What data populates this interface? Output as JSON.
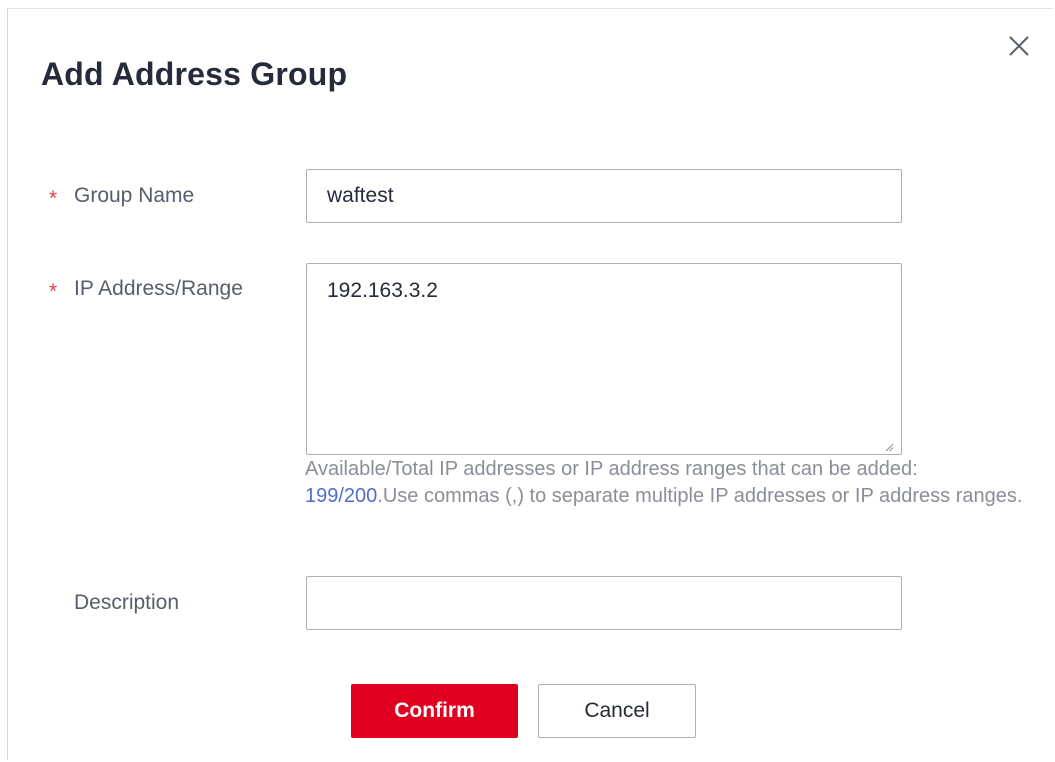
{
  "dialog": {
    "title": "Add Address Group",
    "close_icon": "close-icon"
  },
  "form": {
    "required_mark": "*",
    "group_name": {
      "label": "Group Name",
      "value": "waftest",
      "required": true
    },
    "ip_range": {
      "label": "IP Address/Range",
      "value": "192.163.3.2",
      "required": true,
      "hint_before": "Available/Total IP addresses or IP address ranges that can be added: ",
      "hint_count": "199/200",
      "hint_after": ".Use commas (,) to separate multiple IP addresses or IP address ranges."
    },
    "description": {
      "label": "Description",
      "value": "",
      "required": false
    }
  },
  "actions": {
    "confirm_label": "Confirm",
    "cancel_label": "Cancel"
  },
  "colors": {
    "accent": "#e1001f",
    "required": "#e6404a",
    "link": "#526ecc",
    "hint": "#8a8e99"
  }
}
